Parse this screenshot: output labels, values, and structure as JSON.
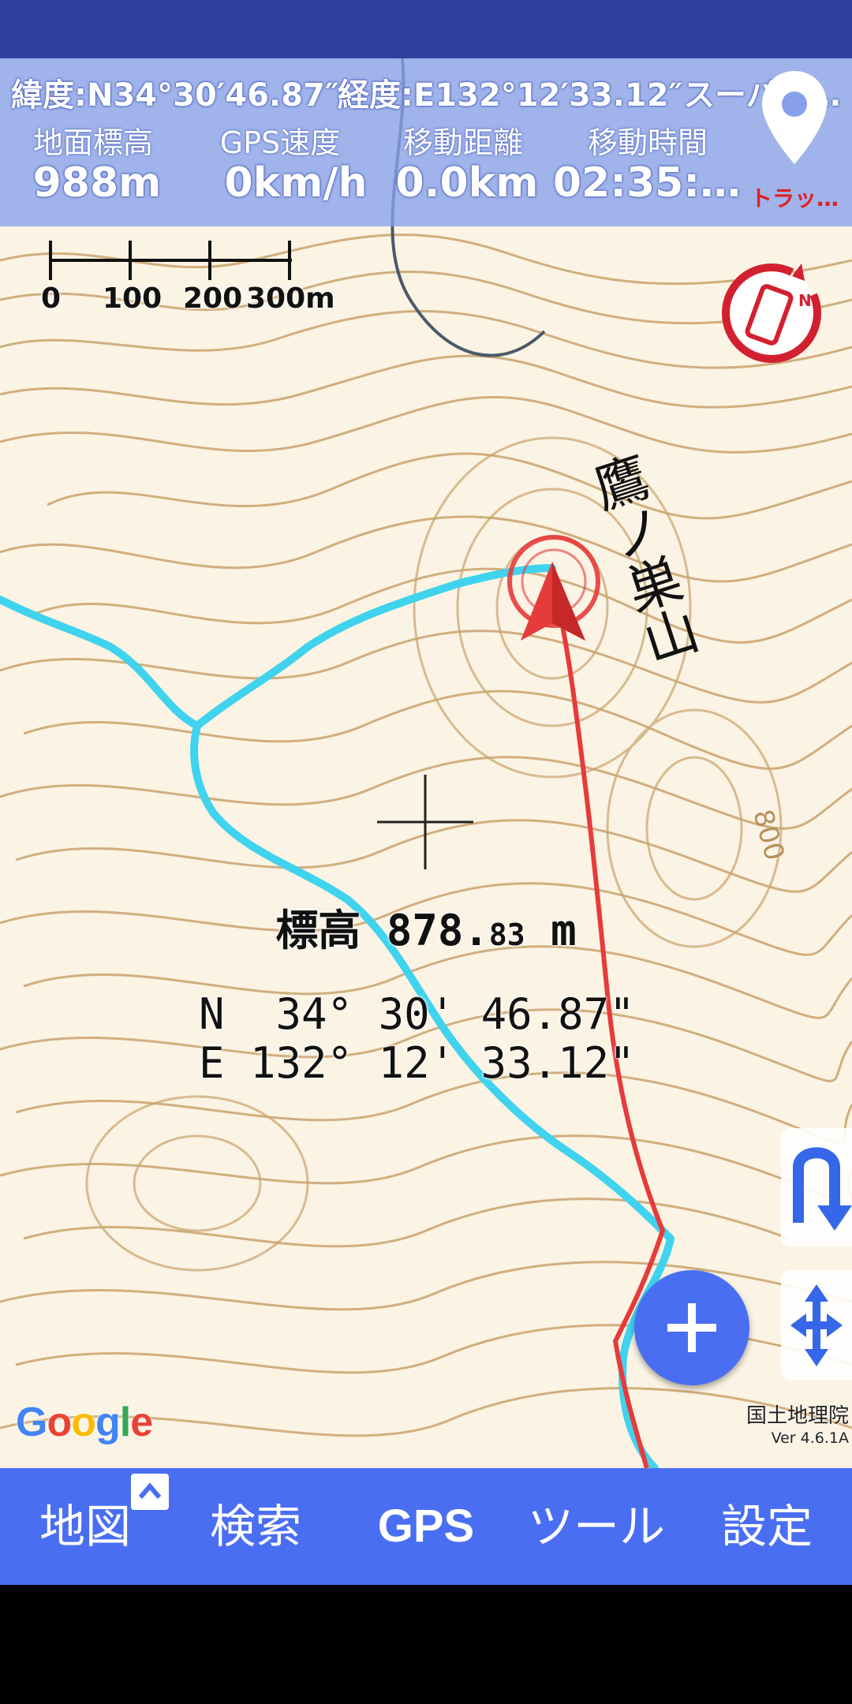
{
  "info_panel": {
    "lat_label": "緯度:N34°30′46.87″",
    "lon_label": "経度:E132°12′33.12″",
    "map_source": "スーパー…",
    "stats": [
      {
        "label": "地面標高",
        "value": "988m"
      },
      {
        "label": "GPS速度",
        "value": "0km/h"
      },
      {
        "label": "移動距離",
        "value": "0.0km"
      },
      {
        "label": "移動時間",
        "value": "02:35:…"
      }
    ],
    "track_label": "トラッ…"
  },
  "scale": {
    "ticks": [
      "0",
      "100",
      "200",
      "300m"
    ]
  },
  "map": {
    "peak_name": "鷹ノ巣山",
    "elevation_label": "標高",
    "elevation_main": "878.",
    "elevation_decimal": "83",
    "elevation_unit": "m",
    "lat_readout": "N  34° 30' 46.87\"",
    "lon_readout": "E 132° 12' 33.12\"",
    "contour_label": "800",
    "google_logo": "Google",
    "attribution": "国土地理院",
    "version": "Ver 4.6.1A"
  },
  "colors": {
    "track_cyan": "#3fd3ee",
    "route_red": "#e63b3b",
    "contour": "#c8a06a",
    "nav_blue": "#4a6ef2"
  },
  "bottom_nav": {
    "items": [
      "地図",
      "検索",
      "GPS",
      "ツール",
      "設定"
    ],
    "expand_icon": "^"
  }
}
